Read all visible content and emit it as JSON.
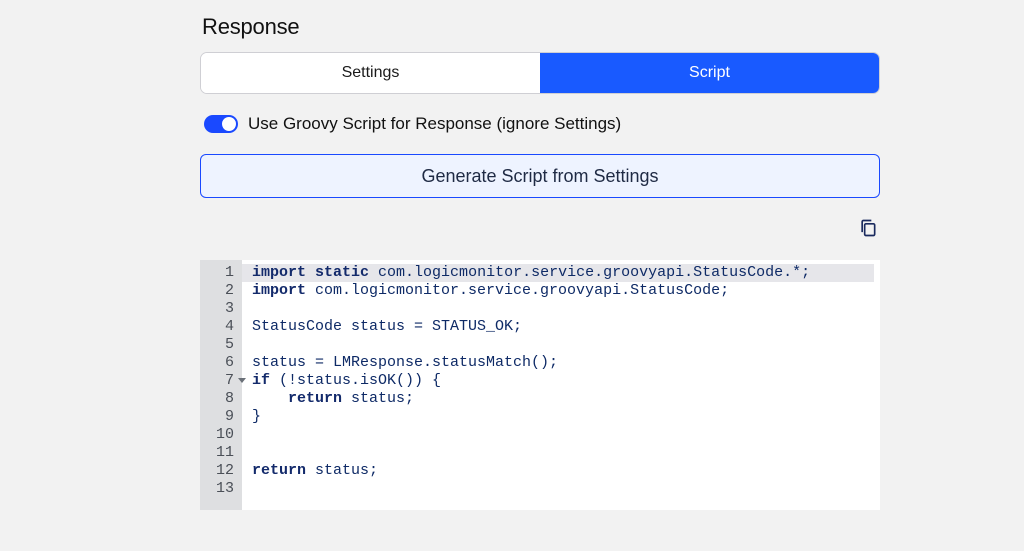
{
  "section": {
    "title": "Response"
  },
  "tabs": {
    "settings": {
      "label": "Settings",
      "active": false
    },
    "script": {
      "label": "Script",
      "active": true
    }
  },
  "toggle": {
    "label": "Use Groovy Script for Response (ignore Settings)",
    "on": true
  },
  "buttons": {
    "generate": "Generate Script from Settings"
  },
  "icons": {
    "copy": "copy-icon"
  },
  "colors": {
    "accent": "#195aff",
    "toggle": "#1a49ff",
    "code_text": "#0e2a66",
    "gutter_bg": "#dedfe1"
  },
  "editor": {
    "highlighted_line": 1,
    "lines": [
      {
        "n": 1,
        "tokens": [
          {
            "t": "import",
            "kw": true
          },
          {
            "t": " "
          },
          {
            "t": "static",
            "kw": true
          },
          {
            "t": " com.logicmonitor.service.groovyapi.StatusCode.*;"
          }
        ]
      },
      {
        "n": 2,
        "tokens": [
          {
            "t": "import",
            "kw": true
          },
          {
            "t": " com.logicmonitor.service.groovyapi.StatusCode;"
          }
        ]
      },
      {
        "n": 3,
        "tokens": []
      },
      {
        "n": 4,
        "tokens": [
          {
            "t": "StatusCode status = STATUS_OK;"
          }
        ]
      },
      {
        "n": 5,
        "tokens": []
      },
      {
        "n": 6,
        "tokens": [
          {
            "t": "status = LMResponse.statusMatch();"
          }
        ]
      },
      {
        "n": 7,
        "foldable": true,
        "tokens": [
          {
            "t": "if",
            "kw": true
          },
          {
            "t": " (!status.isOK()) {"
          }
        ]
      },
      {
        "n": 8,
        "tokens": [
          {
            "t": "    "
          },
          {
            "t": "return",
            "kw": true
          },
          {
            "t": " status;"
          }
        ]
      },
      {
        "n": 9,
        "tokens": [
          {
            "t": "}"
          }
        ]
      },
      {
        "n": 10,
        "tokens": []
      },
      {
        "n": 11,
        "tokens": []
      },
      {
        "n": 12,
        "tokens": [
          {
            "t": "return",
            "kw": true
          },
          {
            "t": " status;"
          }
        ]
      },
      {
        "n": 13,
        "tokens": []
      }
    ]
  }
}
